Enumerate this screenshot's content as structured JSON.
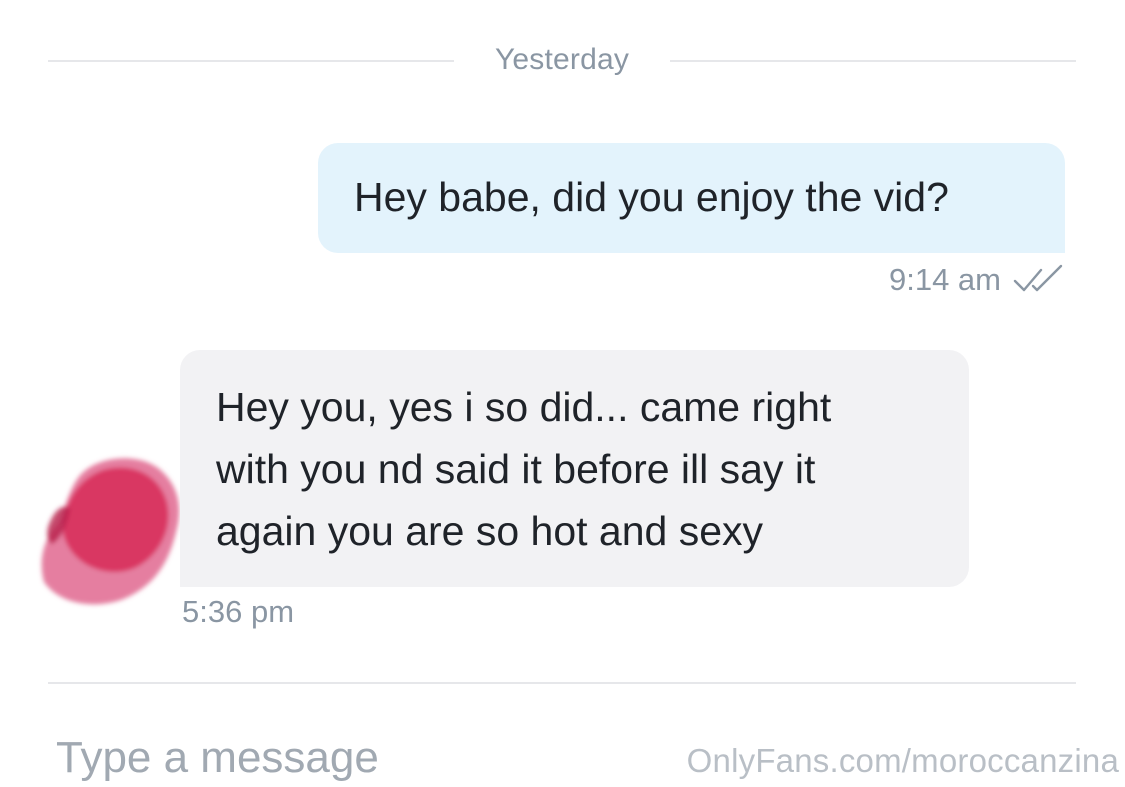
{
  "conversation": {
    "date_divider": "Yesterday",
    "messages": [
      {
        "direction": "outgoing",
        "text": "Hey babe, did you enjoy the vid?",
        "time": "9:14 am",
        "status_icon": "double-check-icon"
      },
      {
        "direction": "incoming",
        "lines": [
          "Hey you, yes i so did... came right",
          "with you nd said it before ill say it",
          "again you are so hot and sexy"
        ],
        "time": "5:36 pm",
        "avatar": "avatar-redacted"
      }
    ]
  },
  "composer": {
    "placeholder": "Type a message"
  },
  "watermark": "OnlyFans.com/moroccanzina",
  "colors": {
    "outgoing_bubble": "#e3f3fc",
    "incoming_bubble": "#f2f2f4",
    "meta_text": "#8a96a3",
    "avatar_redaction": "#d8345f"
  }
}
